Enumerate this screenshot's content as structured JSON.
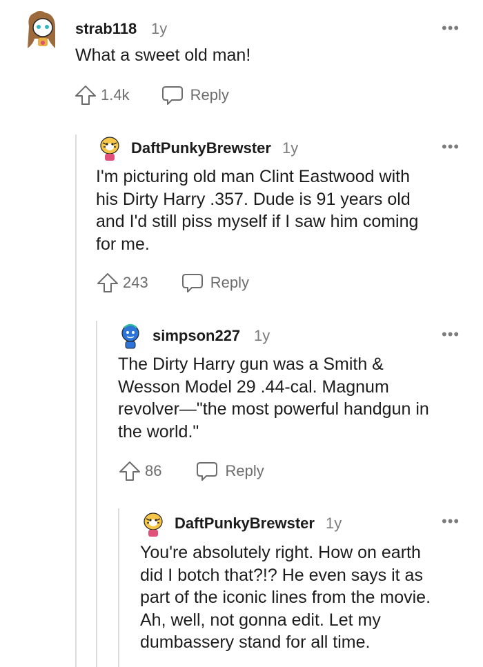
{
  "colors": {
    "text": "#1c1c1c",
    "meta": "#7c7c7c",
    "action": "#6c6c6c",
    "thread_line": "#dadde0"
  },
  "comments": [
    {
      "username": "strab118",
      "age": "1y",
      "more": "•••",
      "body_lines": [
        "What a sweet old man!"
      ],
      "upvotes": "1.4k",
      "reply_label": "Reply",
      "avatar_icon": "snoo-avatar-brown-hair-icon"
    },
    {
      "username": "DaftPunkyBrewster",
      "age": "1y",
      "more": "•••",
      "body_lines": [
        "I'm picturing old man Clint Eastwood with",
        "his Dirty Harry .357. Dude is 91 years old",
        "and I'd still piss myself if I saw him coming",
        "for me."
      ],
      "upvotes": "243",
      "reply_label": "Reply",
      "avatar_icon": "snoo-avatar-tiger-icon"
    },
    {
      "username": "simpson227",
      "age": "1y",
      "more": "•••",
      "body_lines": [
        "The Dirty Harry gun was a Smith &",
        "Wesson Model 29 .44-cal. Magnum",
        "revolver—\"the most powerful handgun in",
        "the world.\""
      ],
      "upvotes": "86",
      "reply_label": "Reply",
      "avatar_icon": "snoo-avatar-blue-icon"
    },
    {
      "username": "DaftPunkyBrewster",
      "age": "1y",
      "more": "•••",
      "body_lines": [
        "You're absolutely right. How on earth",
        "did I botch that?!? He even says it as",
        "part of the iconic lines from the movie.",
        "Ah, well, not gonna edit. Let my",
        "dumbassery stand for all time."
      ],
      "avatar_icon": "snoo-avatar-tiger-icon"
    }
  ]
}
